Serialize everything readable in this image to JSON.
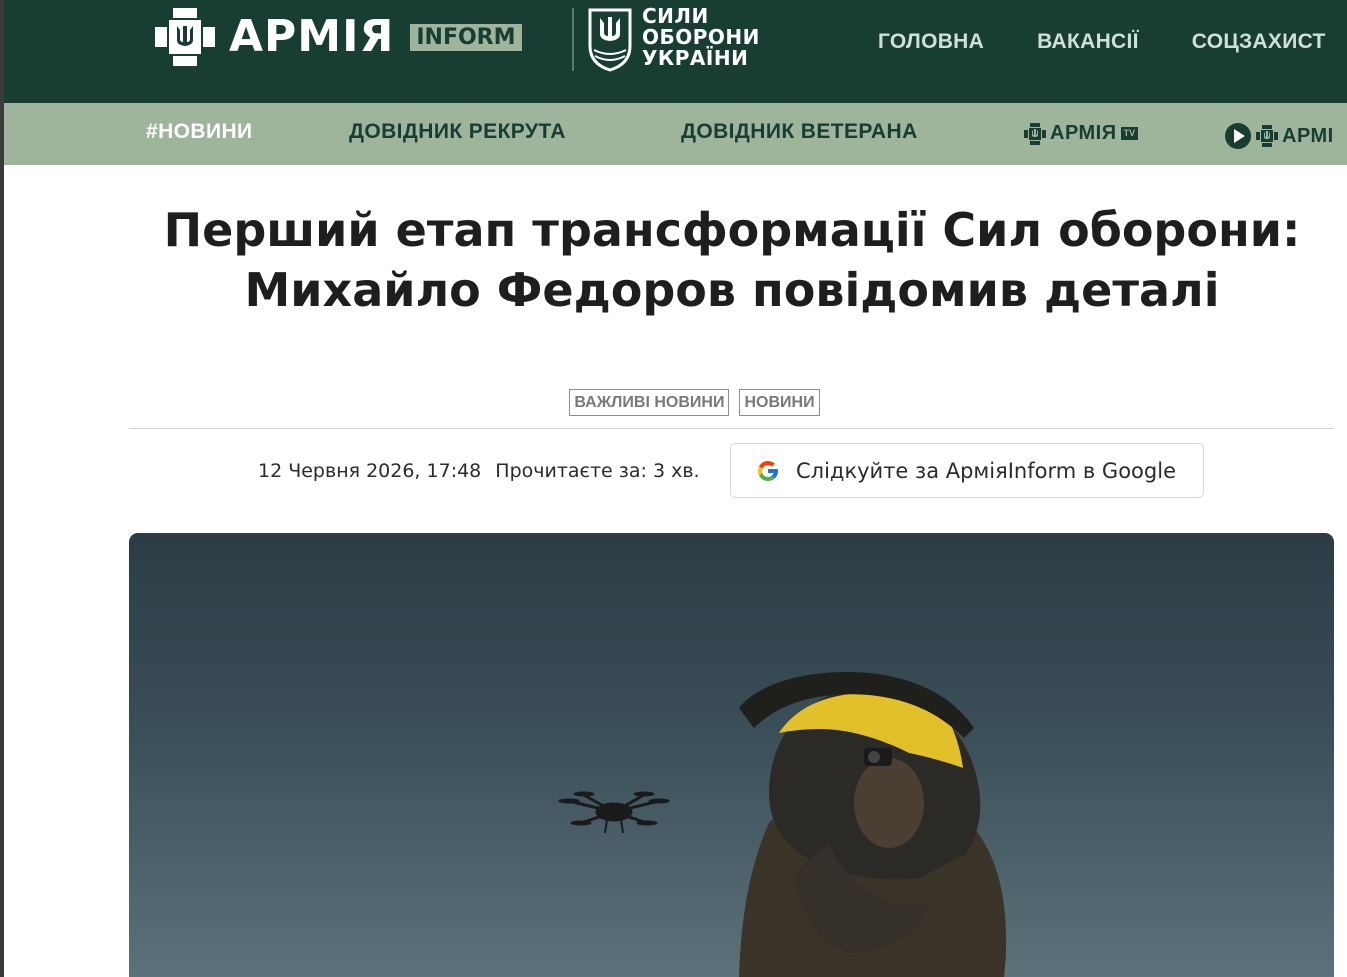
{
  "header": {
    "brand_name": "АРМІЯ",
    "brand_badge": "INFORM",
    "partner_logo_lines": [
      "СИЛИ",
      "ОБОРОНИ",
      "УКРАЇНИ"
    ],
    "nav": [
      "ГОЛОВНА",
      "ВАКАНСІЇ",
      "СОЦЗАХИСТ"
    ]
  },
  "subnav": {
    "news": "#НОВИНИ",
    "recruit_guide": "ДОВІДНИК РЕКРУТА",
    "veteran_guide": "ДОВІДНИК ВЕТЕРАНА",
    "armia_tv": "АРМІЯ",
    "armia_tv_badge": "TV",
    "armia_radio": "АРМІ"
  },
  "article": {
    "title": "Перший етап трансформації Сил оборони: Михайло Федоров повідомив деталі",
    "tags": [
      "ВАЖЛИВІ НОВИНИ",
      "НОВИНИ"
    ],
    "date": "12 Червня 2026, 17:48",
    "read_time": "Прочитаєте за: 3 хв.",
    "follow_button": "Слідкуйте за АрміяInform в Google"
  },
  "colors": {
    "header_bg": "#183d33",
    "subnav_bg": "#9fb59b",
    "accent_yellow": "#e2c02a"
  },
  "icons": {
    "brand_logo": "trident-shield-icon",
    "partner_logo": "trident-shield-icon",
    "follow": "google-icon",
    "radio": "play-circle-icon"
  }
}
